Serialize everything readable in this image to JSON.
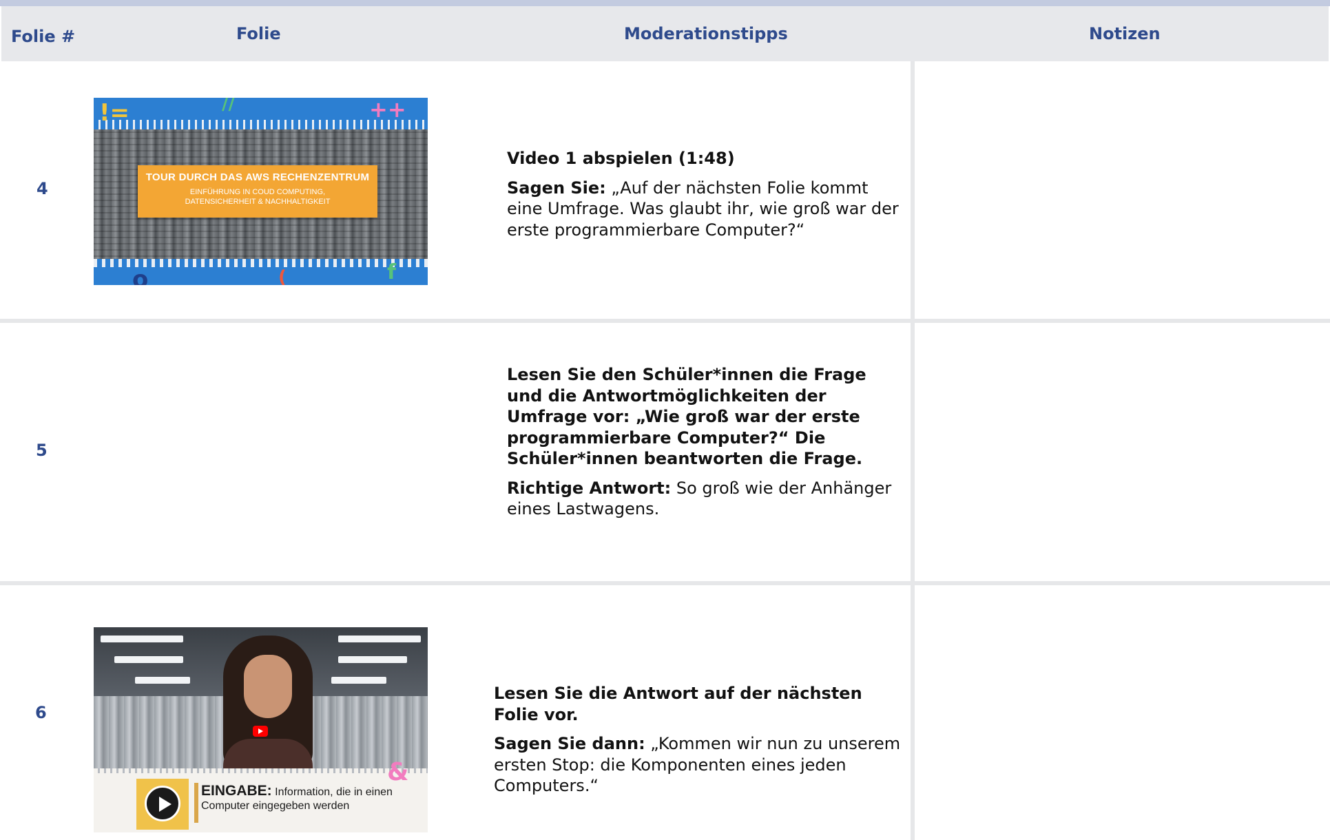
{
  "header": {
    "col_number": "Folie #",
    "col_slide": "Folie",
    "col_tips": "Moderationstipps",
    "col_notes": "Notizen"
  },
  "rows": [
    {
      "number": "4",
      "thumbnail": {
        "banner_title": "TOUR DURCH DAS AWS RECHENZENTRUM",
        "banner_subtitle": "EINFÜHRUNG IN COUD COMPUTING,\nDATENSICHERHEIT & NACHHALTIGKEIT"
      },
      "tips": [
        {
          "bold": "Video 1 abspielen (1:48)",
          "text": ""
        },
        {
          "bold": "Sagen Sie:",
          "text": " „Auf der nächsten Folie kommt eine Umfrage. Was glaubt ihr, wie groß war der erste programmierbare Computer?“"
        }
      ]
    },
    {
      "number": "5",
      "thumbnail": null,
      "tips": [
        {
          "bold": "Lesen Sie den Schüler*innen die Frage und die Antwortmöglichkeiten der Umfrage vor: „Wie groß war der erste programmierbare Computer?“ Die Schüler*innen beantworten die Frage.",
          "text": ""
        },
        {
          "bold": "Richtige Antwort:",
          "text": " So groß wie der Anhänger eines Lastwagens."
        }
      ]
    },
    {
      "number": "6",
      "thumbnail": {
        "caption_bold": "EINGABE:",
        "caption_text": " Information, die in einen Computer eingegeben werden",
        "decor_symbol": "&"
      },
      "tips": [
        {
          "bold": "Lesen Sie die Antwort auf der nächsten Folie vor.",
          "text": ""
        },
        {
          "bold": "Sagen Sie dann:",
          "text": " „Kommen wir nun zu unserem ersten Stop: die Komponenten eines jeden Computers.“"
        }
      ]
    }
  ],
  "colors": {
    "header_bg": "#e7e8eb",
    "header_text": "#2e4a8c",
    "top_bar": "#c3cbe0",
    "separator": "#e6e7e9"
  },
  "icons": {
    "row6_thumbnail": [
      "youtube-play-icon",
      "play-button-icon"
    ]
  }
}
